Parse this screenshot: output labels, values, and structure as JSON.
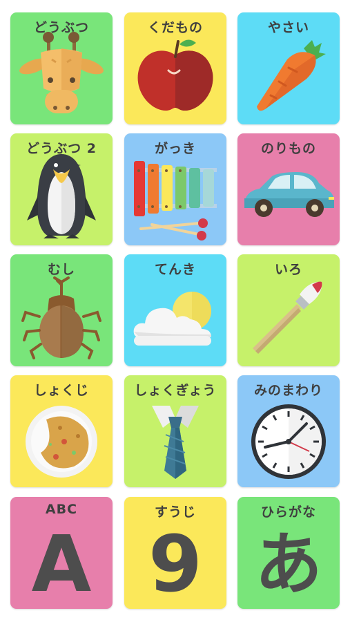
{
  "cards": [
    {
      "label": "どうぶつ",
      "color": "#79e57a",
      "icon": "giraffe-icon"
    },
    {
      "label": "くだもの",
      "color": "#fbe85a",
      "icon": "apple-icon"
    },
    {
      "label": "やさい",
      "color": "#5ddcf6",
      "icon": "carrot-icon"
    },
    {
      "label": "どうぶつ 2",
      "color": "#c6f16a",
      "icon": "penguin-icon"
    },
    {
      "label": "がっき",
      "color": "#8cc8f7",
      "icon": "xylophone-icon"
    },
    {
      "label": "のりもの",
      "color": "#e77fab",
      "icon": "car-icon"
    },
    {
      "label": "むし",
      "color": "#79e57a",
      "icon": "beetle-icon"
    },
    {
      "label": "てんき",
      "color": "#5ddcf6",
      "icon": "weather-icon"
    },
    {
      "label": "いろ",
      "color": "#c6f16a",
      "icon": "paintbrush-icon"
    },
    {
      "label": "しょくじ",
      "color": "#fbe85a",
      "icon": "curry-icon"
    },
    {
      "label": "しょくぎょう",
      "color": "#c6f16a",
      "icon": "necktie-icon"
    },
    {
      "label": "みのまわり",
      "color": "#8cc8f7",
      "icon": "clock-icon"
    },
    {
      "label": "ABC",
      "color": "#e77fab",
      "icon": "letter-a-icon",
      "glyph": "A"
    },
    {
      "label": "すうじ",
      "color": "#fbe85a",
      "icon": "number-9-icon",
      "glyph": "9"
    },
    {
      "label": "ひらがな",
      "color": "#79e57a",
      "icon": "hiragana-a-icon",
      "glyph": "あ"
    }
  ]
}
